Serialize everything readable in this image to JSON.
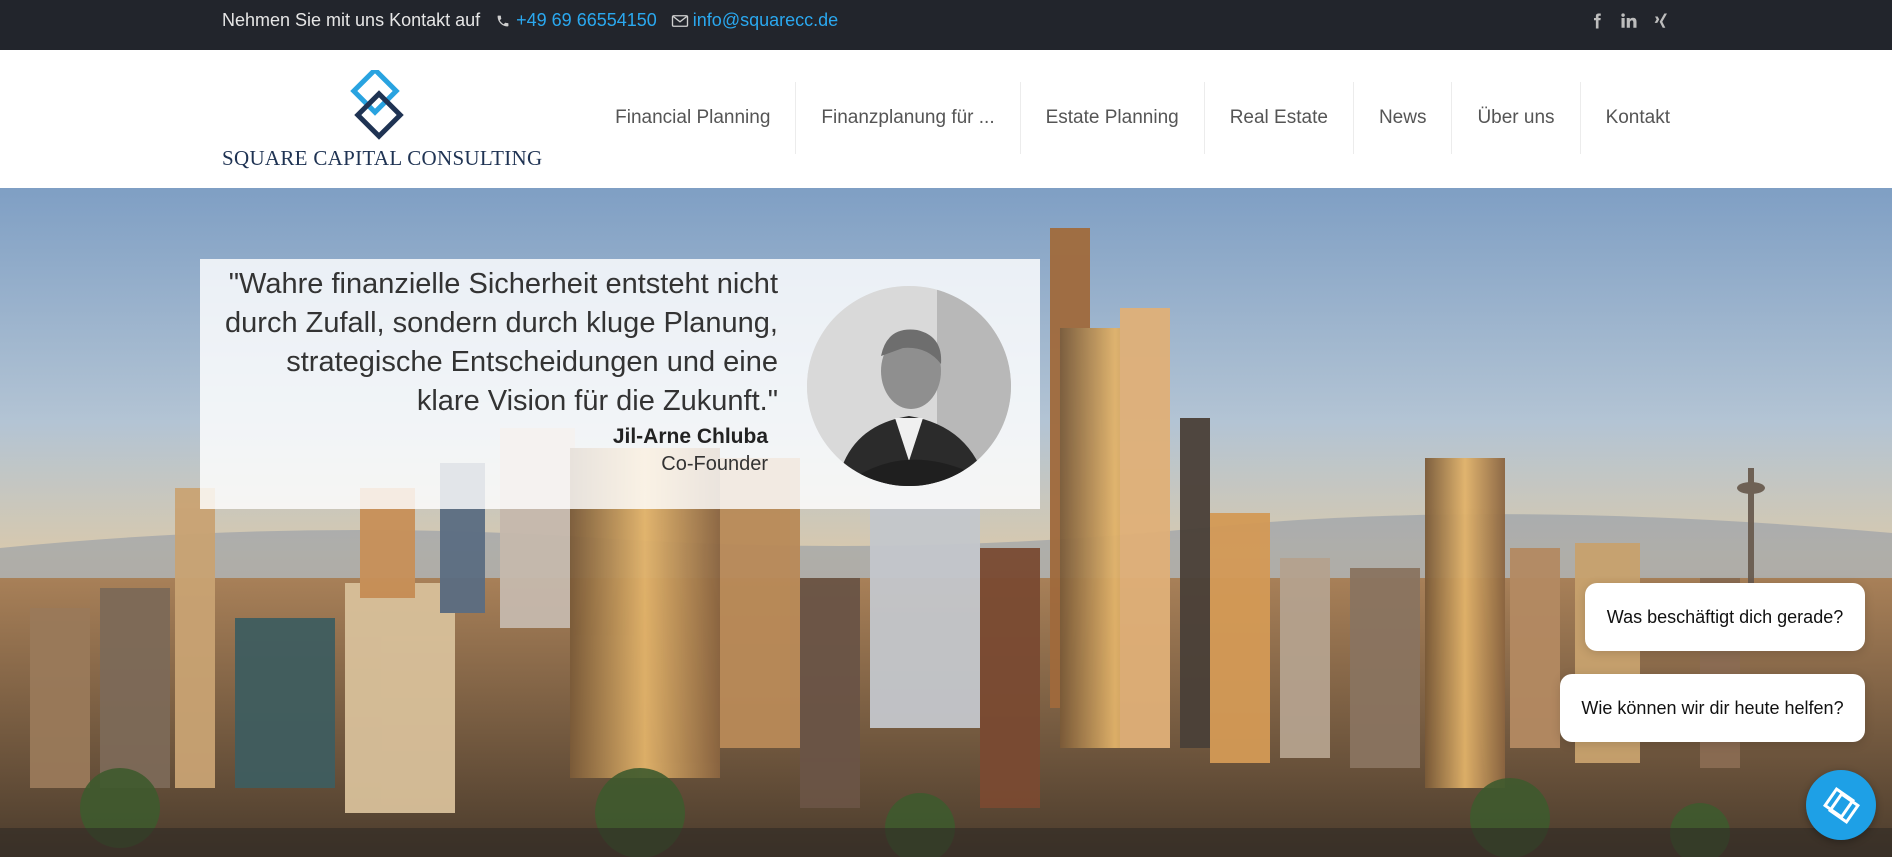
{
  "topbar": {
    "contact_label": "Nehmen Sie mit uns Kontakt auf",
    "phone": "+49 69 66554150",
    "email": "info@squarecc.de",
    "phone_icon": "phone-icon",
    "email_icon": "envelope-icon",
    "social": [
      "facebook-icon",
      "linkedin-icon",
      "xing-icon"
    ]
  },
  "header": {
    "logo_name": "SQUARE CAPITAL CONSULTING",
    "nav": [
      {
        "label": "Financial Planning"
      },
      {
        "label": "Finanzplanung für ..."
      },
      {
        "label": "Estate Planning"
      },
      {
        "label": "Real Estate"
      },
      {
        "label": "News"
      },
      {
        "label": "Über uns"
      },
      {
        "label": "Kontakt"
      }
    ]
  },
  "hero": {
    "quote": "\"Wahre finanzielle Sicherheit entsteht nicht durch Zufall, sondern durch kluge Planung, strategische Entscheidungen und eine klare Vision für die Zukunft.\"",
    "author_name": "Jil-Arne Chluba",
    "author_role": "Co-Founder"
  },
  "chat": {
    "bubble1": "Was beschäftigt dich gerade?",
    "bubble2": "Wie können wir dir heute helfen?"
  },
  "colors": {
    "topbar_bg": "#22252c",
    "link": "#2aa8ef",
    "brand_dark": "#1f3353",
    "brand_light": "#29a3e0",
    "chat": "#1ea0e6"
  }
}
